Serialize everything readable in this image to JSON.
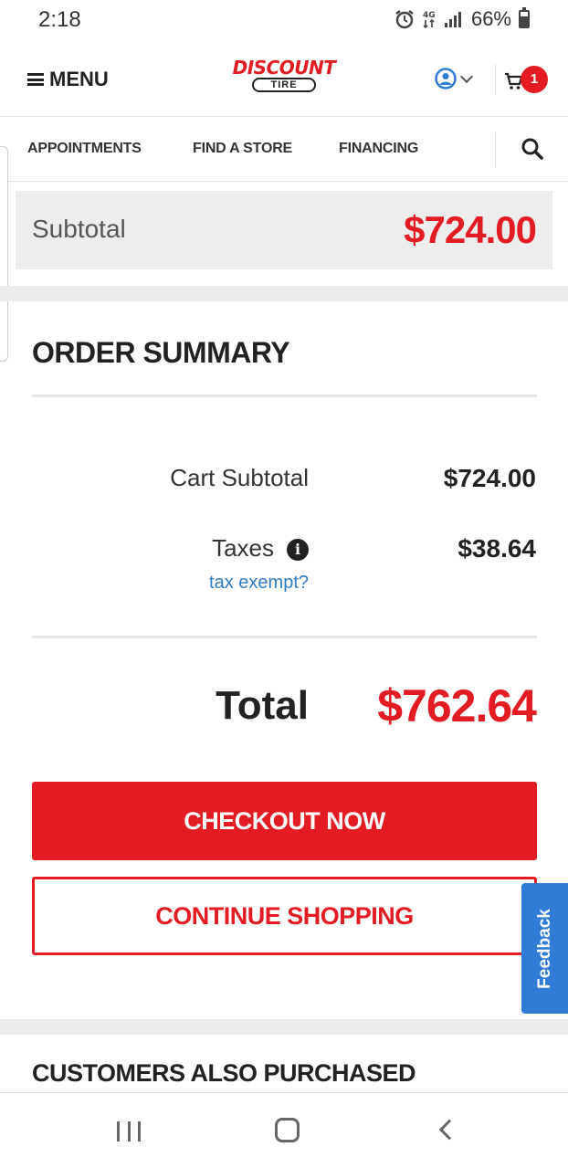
{
  "status_bar": {
    "time": "2:18",
    "battery": "66%",
    "icons": [
      "alarm-icon",
      "data-4g-icon",
      "signal-icon",
      "battery-icon"
    ]
  },
  "header": {
    "menu_label": "MENU",
    "logo_top": "DISCOUNT",
    "logo_bottom": "TIRE",
    "cart_count": "1"
  },
  "nav": {
    "items": [
      "APPOINTMENTS",
      "FIND A STORE",
      "FINANCING"
    ]
  },
  "subtotal_bar": {
    "label": "Subtotal",
    "value": "$724.00"
  },
  "order_summary": {
    "title": "ORDER SUMMARY",
    "cart_subtotal_label": "Cart Subtotal",
    "cart_subtotal_value": "$724.00",
    "taxes_label": "Taxes",
    "taxes_value": "$38.64",
    "tax_exempt_link": "tax exempt?",
    "total_label": "Total",
    "total_value": "$762.64"
  },
  "buttons": {
    "checkout": "CHECKOUT NOW",
    "continue": "CONTINUE SHOPPING",
    "feedback": "Feedback"
  },
  "also_purchased": {
    "title": "CUSTOMERS ALSO PURCHASED"
  },
  "colors": {
    "brand_red": "#e31b23",
    "link_blue": "#2f7bc1",
    "feedback_blue": "#2f7bd6"
  }
}
